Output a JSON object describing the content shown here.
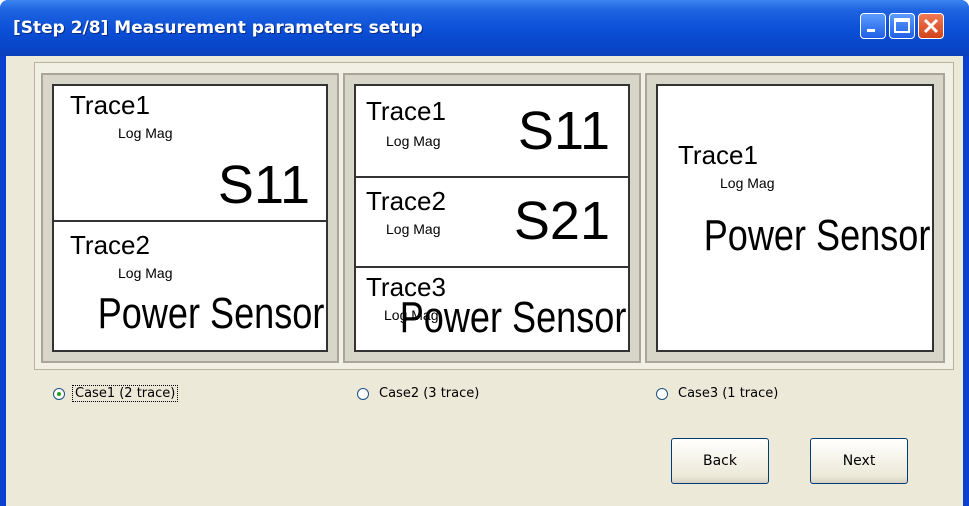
{
  "window": {
    "title": "[Step 2/8] Measurement parameters setup"
  },
  "icons": {
    "minimize": "minimize-icon",
    "maximize": "maximize-icon",
    "close": "close-icon"
  },
  "cases": [
    {
      "label": "Case1  (2 trace)",
      "selected": true,
      "traces": [
        {
          "name": "Trace1",
          "format": "Log Mag",
          "param": "S11"
        },
        {
          "name": "Trace2",
          "format": "Log Mag",
          "param": "Power Sensor"
        }
      ]
    },
    {
      "label": "Case2  (3 trace)",
      "selected": false,
      "traces": [
        {
          "name": "Trace1",
          "format": "Log Mag",
          "param": "S11"
        },
        {
          "name": "Trace2",
          "format": "Log Mag",
          "param": "S21"
        },
        {
          "name": "Trace3",
          "format": "Log Mag",
          "param": "Power Sensor"
        }
      ]
    },
    {
      "label": "Case3  (1 trace)",
      "selected": false,
      "traces": [
        {
          "name": "Trace1",
          "format": "Log Mag",
          "param": "Power Sensor"
        }
      ]
    }
  ],
  "buttons": {
    "back": "Back",
    "next": "Next"
  }
}
